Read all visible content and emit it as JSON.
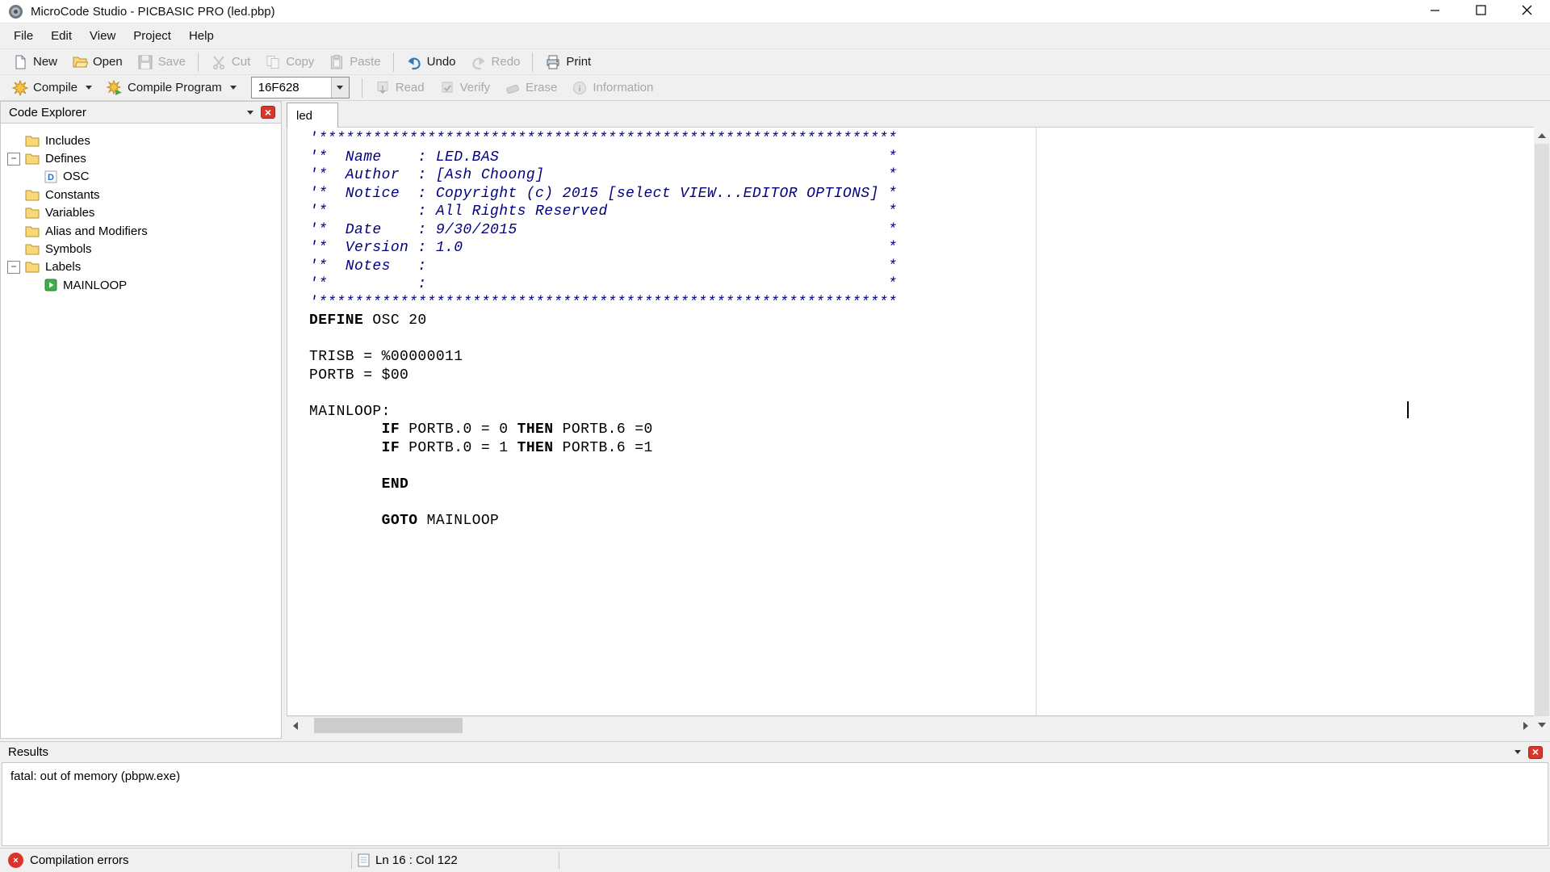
{
  "colors": {
    "comment": "#000080",
    "error_red": "#d9352a",
    "folder_yellow": "#f9d87a",
    "accent_blue": "#2e7bbe"
  },
  "window": {
    "title": "MicroCode Studio - PICBASIC PRO (led.pbp)"
  },
  "menubar": {
    "items": [
      "File",
      "Edit",
      "View",
      "Project",
      "Help"
    ]
  },
  "toolbar": {
    "groups": [
      [
        {
          "label": "New",
          "icon": "new-file",
          "enabled": true
        },
        {
          "label": "Open",
          "icon": "open-folder",
          "enabled": true
        },
        {
          "label": "Save",
          "icon": "save-disk",
          "enabled": false
        }
      ],
      [
        {
          "label": "Cut",
          "icon": "scissors",
          "enabled": false
        },
        {
          "label": "Copy",
          "icon": "copy-pages",
          "enabled": false
        },
        {
          "label": "Paste",
          "icon": "clipboard",
          "enabled": false
        }
      ],
      [
        {
          "label": "Undo",
          "icon": "undo-arrow",
          "enabled": true
        },
        {
          "label": "Redo",
          "icon": "redo-arrow",
          "enabled": false
        }
      ],
      [
        {
          "label": "Print",
          "icon": "printer",
          "enabled": true
        }
      ]
    ]
  },
  "compilebar": {
    "compile": "Compile",
    "compile_program": "Compile Program",
    "device": "16F628",
    "tools": [
      {
        "label": "Read",
        "icon": "read",
        "enabled": false
      },
      {
        "label": "Verify",
        "icon": "verify",
        "enabled": false
      },
      {
        "label": "Erase",
        "icon": "erase",
        "enabled": false
      },
      {
        "label": "Information",
        "icon": "info",
        "enabled": false
      }
    ]
  },
  "explorer": {
    "title": "Code Explorer",
    "items": [
      {
        "label": "Includes",
        "depth": 0,
        "icon": "folder",
        "toggle": null
      },
      {
        "label": "Defines",
        "depth": 0,
        "icon": "folder",
        "toggle": "minus"
      },
      {
        "label": "OSC",
        "depth": 1,
        "icon": "define",
        "toggle": null
      },
      {
        "label": "Constants",
        "depth": 0,
        "icon": "folder",
        "toggle": null
      },
      {
        "label": "Variables",
        "depth": 0,
        "icon": "folder",
        "toggle": null
      },
      {
        "label": "Alias and Modifiers",
        "depth": 0,
        "icon": "folder",
        "toggle": null
      },
      {
        "label": "Symbols",
        "depth": 0,
        "icon": "folder",
        "toggle": null
      },
      {
        "label": "Labels",
        "depth": 0,
        "icon": "folder",
        "toggle": "minus"
      },
      {
        "label": "MAINLOOP",
        "depth": 1,
        "icon": "play",
        "toggle": null
      }
    ]
  },
  "editor": {
    "tab": "led",
    "code": [
      [
        [
          "c",
          "'****************************************************************"
        ]
      ],
      [
        [
          "c",
          "'*  Name    : LED.BAS                                           *"
        ]
      ],
      [
        [
          "c",
          "'*  Author  : [Ash Choong]                                      *"
        ]
      ],
      [
        [
          "c",
          "'*  Notice  : Copyright (c) 2015 [select VIEW...EDITOR OPTIONS] *"
        ]
      ],
      [
        [
          "c",
          "'*          : All Rights Reserved                               *"
        ]
      ],
      [
        [
          "c",
          "'*  Date    : 9/30/2015                                         *"
        ]
      ],
      [
        [
          "c",
          "'*  Version : 1.0                                               *"
        ]
      ],
      [
        [
          "c",
          "'*  Notes   :                                                   *"
        ]
      ],
      [
        [
          "c",
          "'*          :                                                   *"
        ]
      ],
      [
        [
          "c",
          "'****************************************************************"
        ]
      ],
      [
        [
          "k",
          "DEFINE"
        ],
        [
          "p",
          " OSC 20"
        ]
      ],
      [],
      [
        [
          "p",
          "TRISB = %00000011"
        ]
      ],
      [
        [
          "p",
          "PORTB = $00"
        ]
      ],
      [],
      [
        [
          "p",
          "MAINLOOP:"
        ]
      ],
      [
        [
          "p",
          "        "
        ],
        [
          "k",
          "IF"
        ],
        [
          "p",
          " PORTB.0 = 0 "
        ],
        [
          "k",
          "THEN"
        ],
        [
          "p",
          " PORTB.6 =0"
        ]
      ],
      [
        [
          "p",
          "        "
        ],
        [
          "k",
          "IF"
        ],
        [
          "p",
          " PORTB.0 = 1 "
        ],
        [
          "k",
          "THEN"
        ],
        [
          "p",
          " PORTB.6 =1"
        ]
      ],
      [],
      [
        [
          "p",
          "        "
        ],
        [
          "k",
          "END"
        ]
      ],
      [],
      [
        [
          "p",
          "        "
        ],
        [
          "k",
          "GOTO"
        ],
        [
          "p",
          " MAINLOOP"
        ]
      ]
    ]
  },
  "results": {
    "title": "Results",
    "message": "fatal: out of memory (pbpw.exe)"
  },
  "statusbar": {
    "status": "Compilation errors",
    "position": "Ln 16 : Col 122"
  }
}
